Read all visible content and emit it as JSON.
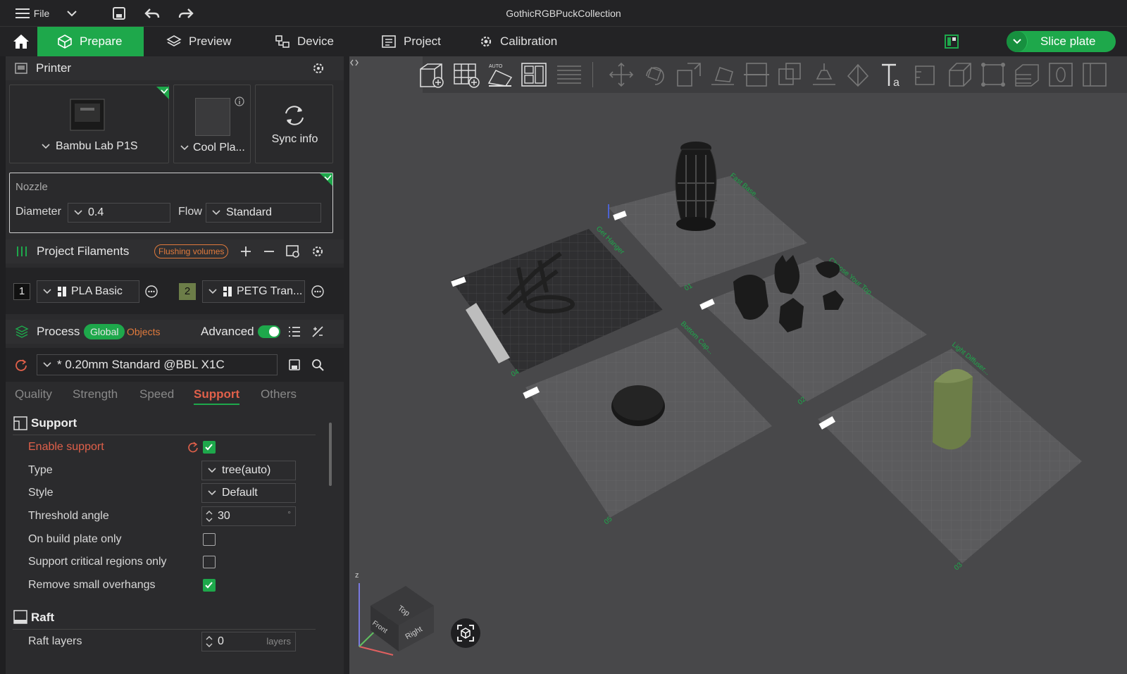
{
  "window": {
    "title": "GothicRGBPuckCollection",
    "file_label": "File"
  },
  "tabs": [
    {
      "label": "Prepare"
    },
    {
      "label": "Preview"
    },
    {
      "label": "Device"
    },
    {
      "label": "Project"
    },
    {
      "label": "Calibration"
    }
  ],
  "slice_label": "Slice plate",
  "printer": {
    "header": "Printer",
    "model": "Bambu Lab P1S",
    "plate": "Cool Pla...",
    "sync": "Sync info"
  },
  "nozzle": {
    "header": "Nozzle",
    "diameter_label": "Diameter",
    "diameter_value": "0.4",
    "flow_label": "Flow",
    "flow_value": "Standard"
  },
  "filaments": {
    "header": "Project Filaments",
    "flushing": "Flushing volumes",
    "items": [
      {
        "num": "1",
        "name": "PLA Basic",
        "color": "#111111"
      },
      {
        "num": "2",
        "name": "PETG Tran...",
        "color": "#6c7d48"
      }
    ]
  },
  "process": {
    "header": "Process",
    "global": "Global",
    "objects": "Objects",
    "advanced": "Advanced",
    "preset": "* 0.20mm Standard @BBL X1C"
  },
  "subtabs": [
    "Quality",
    "Strength",
    "Speed",
    "Support",
    "Others"
  ],
  "support": {
    "header": "Support",
    "enable": "Enable support",
    "type_label": "Type",
    "type_value": "tree(auto)",
    "style_label": "Style",
    "style_value": "Default",
    "threshold_label": "Threshold angle",
    "threshold_value": "30",
    "threshold_unit": "°",
    "build_plate": "On build plate only",
    "critical": "Support critical regions only",
    "remove_small": "Remove small overhangs"
  },
  "raft": {
    "header": "Raft",
    "layers_label": "Raft layers",
    "layers_value": "0",
    "layers_unit": "layers"
  },
  "plates": [
    {
      "label": "01",
      "tag": "Fast Base..."
    },
    {
      "label": "04",
      "tag": "Get Hanger"
    },
    {
      "label": "02",
      "tag": "Choose Your Top..."
    },
    {
      "label": "05",
      "tag": "Bottom Cap..."
    },
    {
      "label": "03",
      "tag": "Light Diffuser..."
    }
  ],
  "view_cube": {
    "top": "Top",
    "front": "Front",
    "right": "Right"
  },
  "colors": {
    "accent": "#1ea84b",
    "warning": "#e0604a",
    "flush": "#e07a3c"
  }
}
